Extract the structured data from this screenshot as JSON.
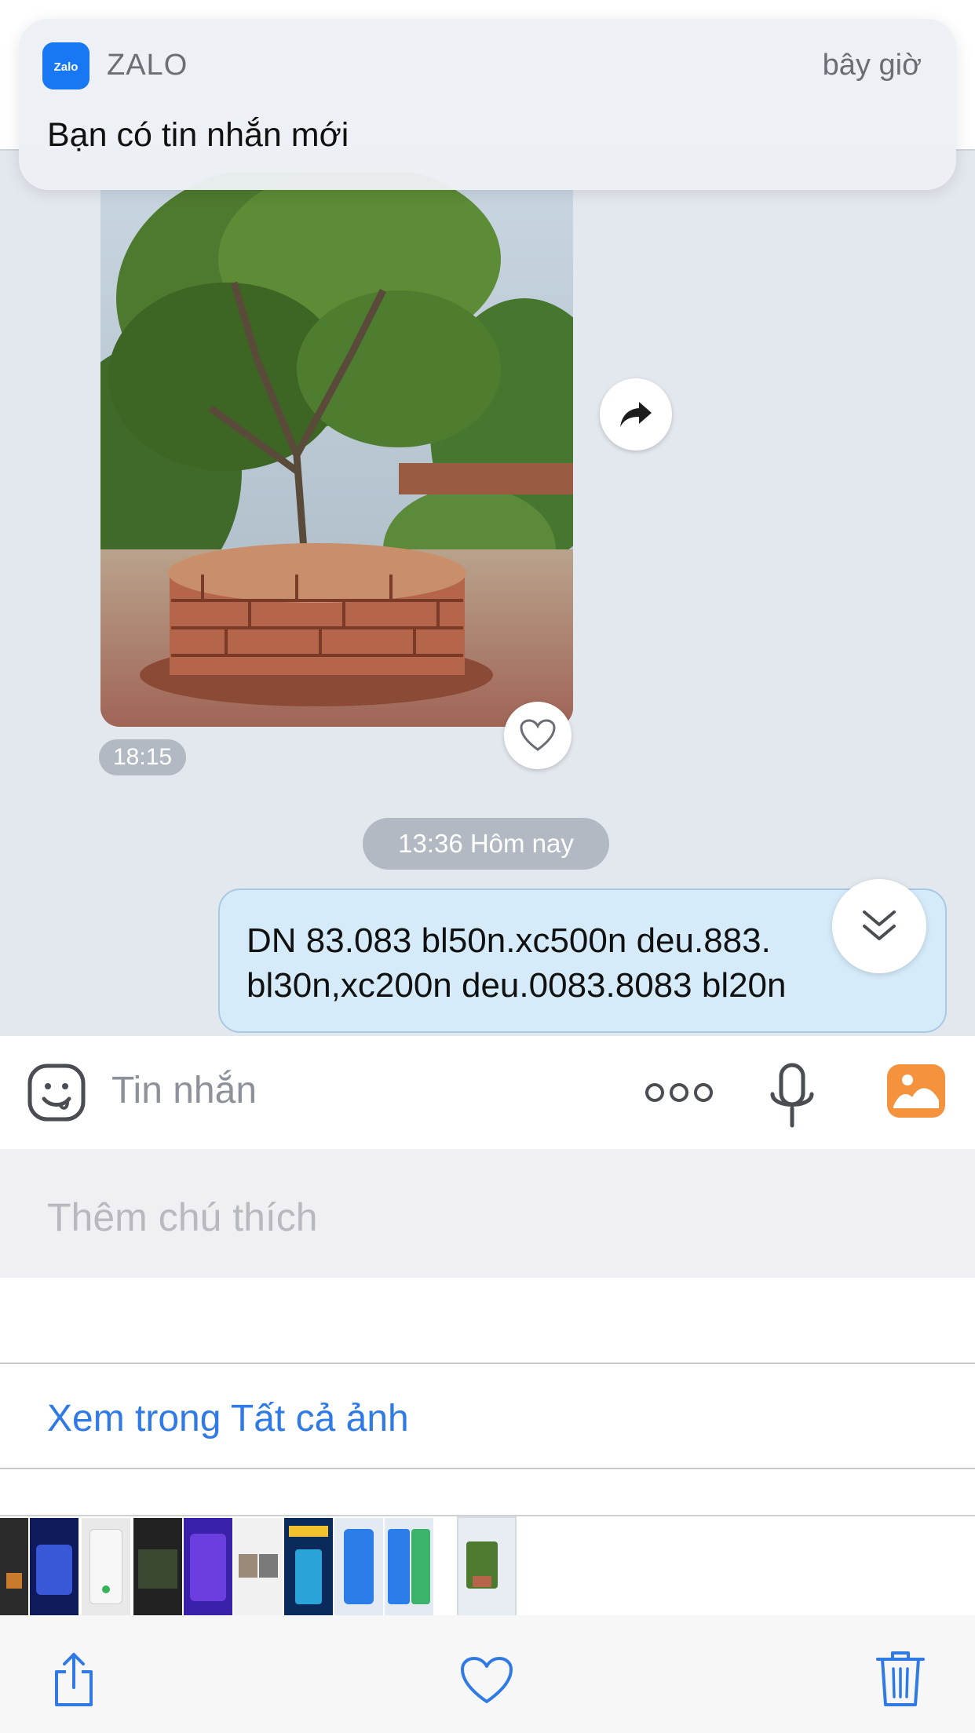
{
  "notification": {
    "app_name": "ZALO",
    "time": "bây giờ",
    "body": "Bạn có tin nhắn mới",
    "icon_text": "Zalo"
  },
  "chat": {
    "photo_time": "18:15",
    "date_separator": "13:36 Hôm nay",
    "message_lines": [
      "DN 83.083 bl50n.xc500n deu.883.",
      "bl30n,xc200n deu.0083.8083 bl20n"
    ]
  },
  "input_bar": {
    "placeholder": "Tin nhắn"
  },
  "photos_sheet": {
    "caption_placeholder": "Thêm chú thích",
    "view_all_label": "Xem trong Tất cả ảnh"
  },
  "colors": {
    "accent_blue": "#2f7ae5",
    "zalo_blue": "#1877f2",
    "bubble_bg": "#d5ebf9",
    "gallery_orange": "#f5923e"
  },
  "icons": {
    "share": "share-icon",
    "like": "heart-icon",
    "scroll_down": "chevron-double-down-icon",
    "emoji": "emoji-icon",
    "more": "more-dots-icon",
    "mic": "microphone-icon",
    "gallery": "gallery-icon",
    "toolbar_share": "share-upload-icon",
    "toolbar_favorite": "heart-outline-icon",
    "toolbar_delete": "trash-icon"
  }
}
